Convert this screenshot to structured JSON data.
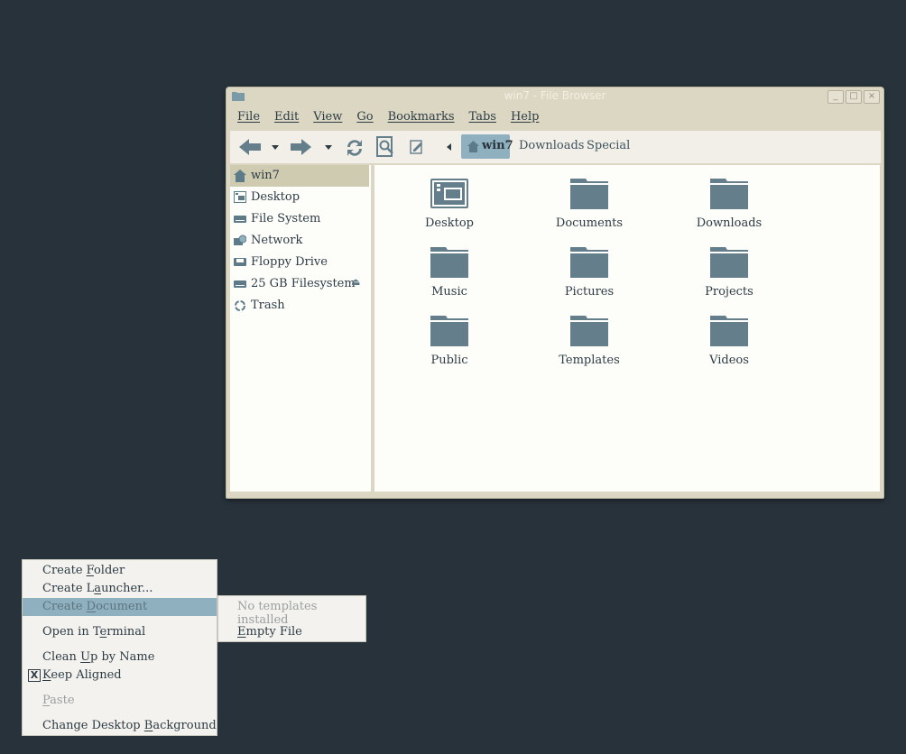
{
  "window": {
    "title": "win7 - File Browser",
    "controls": {
      "minimize": "_",
      "maximize": "□",
      "close": "×"
    }
  },
  "menubar": [
    "File",
    "Edit",
    "View",
    "Go",
    "Bookmarks",
    "Tabs",
    "Help"
  ],
  "toolbar": {
    "back_icon": "back-arrow-icon",
    "forward_icon": "forward-arrow-icon",
    "reload_icon": "reload-icon",
    "search_icon": "search-icon",
    "edit_icon": "edit-path-icon",
    "breadcrumb": {
      "current": "win7",
      "items": [
        "Downloads",
        "Special"
      ]
    }
  },
  "sidebar": {
    "items": [
      {
        "label": "win7",
        "icon": "home-icon",
        "selected": true
      },
      {
        "label": "Desktop",
        "icon": "desktop-icon"
      },
      {
        "label": "File System",
        "icon": "drive-icon"
      },
      {
        "label": "Network",
        "icon": "network-icon"
      },
      {
        "label": "Floppy Drive",
        "icon": "floppy-icon"
      },
      {
        "label": "25 GB Filesystem",
        "icon": "drive-icon",
        "eject": "⏏"
      },
      {
        "label": "Trash",
        "icon": "trash-icon"
      }
    ]
  },
  "files": [
    "Desktop",
    "Documents",
    "Downloads",
    "Music",
    "Pictures",
    "Projects",
    "Public",
    "Templates",
    "Videos"
  ],
  "context_menu": {
    "items": {
      "create_folder": {
        "pre": "Create ",
        "u": "F",
        "post": "older"
      },
      "create_launcher": {
        "pre": "Create L",
        "u": "a",
        "post": "uncher..."
      },
      "create_document": {
        "pre": "Create ",
        "u": "D",
        "post": "ocument"
      },
      "open_terminal": {
        "pre": "Open in T",
        "u": "e",
        "post": "rminal"
      },
      "clean_up": {
        "pre": "Clean ",
        "u": "U",
        "post": "p by Name"
      },
      "keep_aligned": {
        "pre": "",
        "u": "K",
        "post": "eep Aligned",
        "check": "X"
      },
      "paste": {
        "pre": "",
        "u": "P",
        "post": "aste"
      },
      "change_bg": {
        "pre": "Change Desktop ",
        "u": "B",
        "post": "ackground"
      }
    }
  },
  "submenu": {
    "no_templates": "No templates installed",
    "empty_file": {
      "pre": "",
      "u": "E",
      "post": "mpty File"
    }
  },
  "colors": {
    "desktop": "#27323a",
    "accent": "#8fb0bf",
    "folder": "#647f8b",
    "selection": "#cfcbb0"
  }
}
